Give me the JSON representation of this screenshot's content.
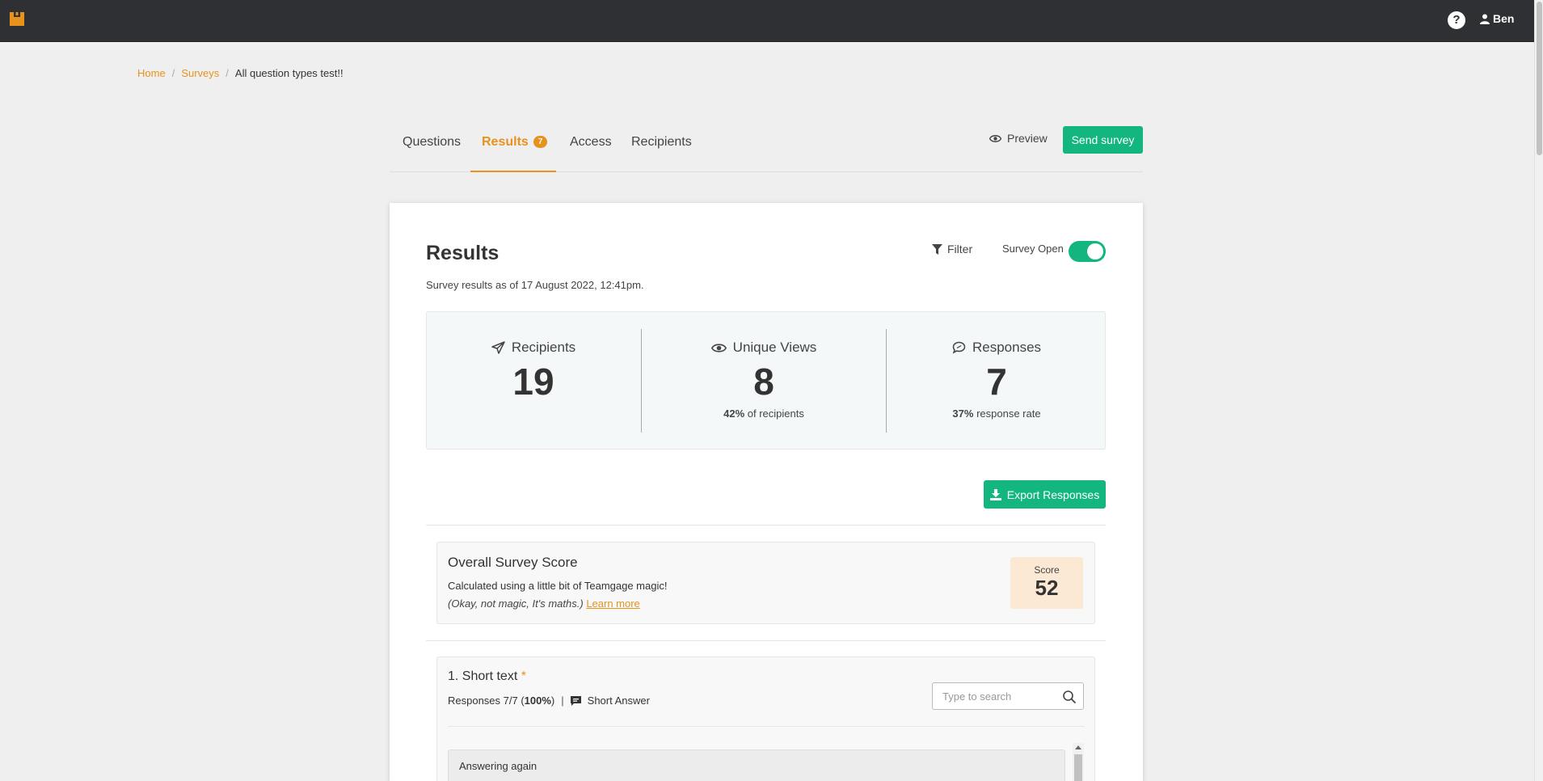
{
  "header": {
    "user_name": "Ben",
    "brand_color": "#e8921e"
  },
  "breadcrumb": {
    "items": [
      "Home",
      "Surveys"
    ],
    "current": "All question types test!!"
  },
  "tabs": [
    {
      "label": "Questions"
    },
    {
      "label": "Results",
      "badge": "7",
      "active": true
    },
    {
      "label": "Access"
    },
    {
      "label": "Recipients"
    }
  ],
  "actions": {
    "preview_label": "Preview",
    "send_label": "Send survey"
  },
  "results": {
    "title": "Results",
    "subtitle": "Survey results as of 17 August 2022, 12:41pm.",
    "filter_label": "Filter",
    "survey_open_label": "Survey Open",
    "survey_open": true
  },
  "stats": {
    "recipients": {
      "label": "Recipients",
      "value": "19"
    },
    "views": {
      "label": "Unique Views",
      "value": "8",
      "pct": "42%",
      "note": " of recipients"
    },
    "responses": {
      "label": "Responses",
      "value": "7",
      "pct": "37%",
      "note": " response rate"
    }
  },
  "export": {
    "label": "Export Responses"
  },
  "score": {
    "title": "Overall Survey Score",
    "line1": "Calculated using a little bit of Teamgage magic!",
    "line2": "(Okay, not magic, It's maths.)",
    "learn_more": "Learn more",
    "label": "Score",
    "value": "52"
  },
  "question": {
    "title": "1. Short text",
    "required_mark": "*",
    "responses_prefix": "Responses 7/7 (",
    "responses_pct": "100%",
    "responses_suffix": ")",
    "type_label": "Short Answer",
    "search_placeholder": "Type to search",
    "answers": [
      "Answering again"
    ]
  }
}
